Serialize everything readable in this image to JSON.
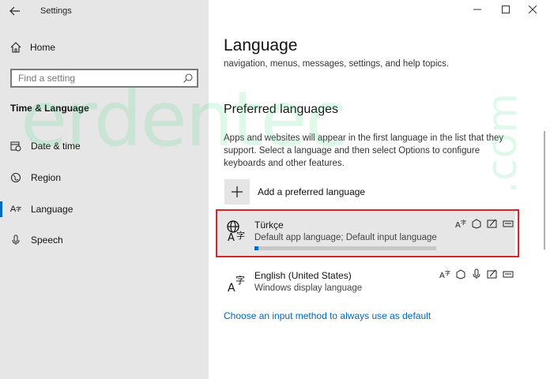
{
  "window": {
    "title": "Settings"
  },
  "sidebar": {
    "home_label": "Home",
    "search_placeholder": "Find a setting",
    "section_title": "Time & Language",
    "items": [
      {
        "label": "Date & time",
        "icon": "calendar-clock-icon"
      },
      {
        "label": "Region",
        "icon": "globe-icon"
      },
      {
        "label": "Language",
        "icon": "language-icon",
        "active": true
      },
      {
        "label": "Speech",
        "icon": "microphone-icon"
      }
    ]
  },
  "main": {
    "title": "Language",
    "truncated_text": "navigation, menus, messages, settings, and help topics.",
    "preferred_heading": "Preferred languages",
    "preferred_description": "Apps and websites will appear in the first language in the list that they support. Select a language and then select Options to configure keyboards and other features.",
    "add_label": "Add a preferred language",
    "languages": [
      {
        "name": "Türkçe",
        "subtitle": "Default app language; Default input language",
        "progress": 0.02
      },
      {
        "name": "English (United States)",
        "subtitle": "Windows display language"
      }
    ],
    "input_method_link": "Choose an input method to always use as default"
  },
  "watermark": {
    "text": "erdentec",
    "suffix": ".com",
    "color": "#46dc8c"
  },
  "colors": {
    "accent": "#0067c0",
    "highlight": "#d9232e"
  }
}
